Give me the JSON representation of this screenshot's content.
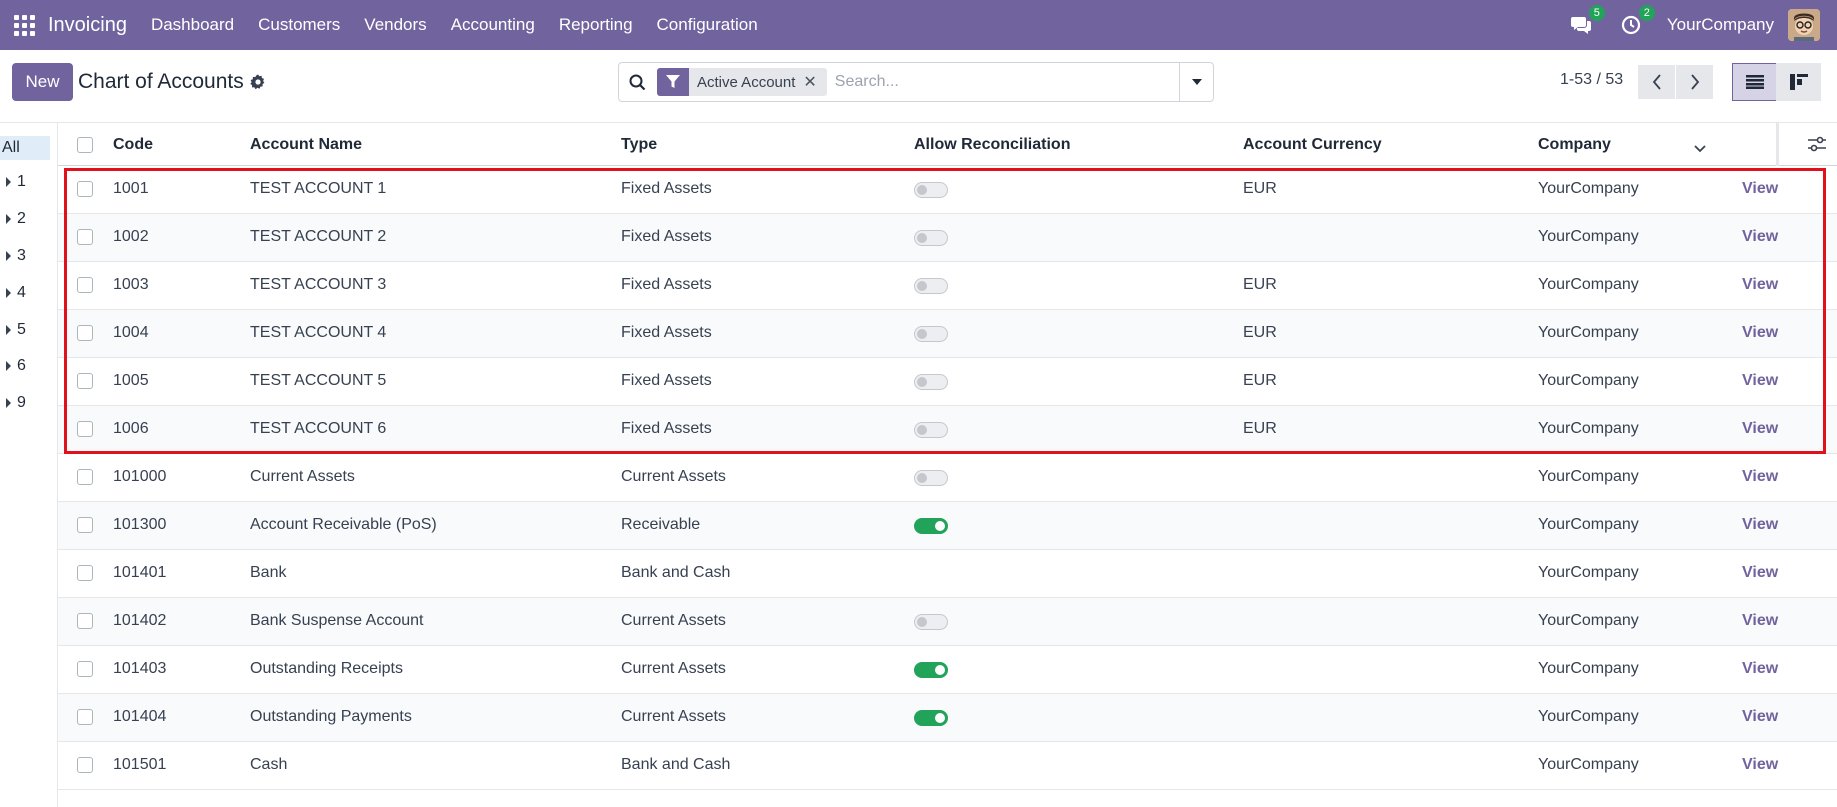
{
  "navbar": {
    "app_name": "Invoicing",
    "menu": [
      "Dashboard",
      "Customers",
      "Vendors",
      "Accounting",
      "Reporting",
      "Configuration"
    ],
    "messages_count": "5",
    "activities_count": "2",
    "company": "YourCompany",
    "bg_color": "#71639e"
  },
  "control": {
    "new_label": "New",
    "title": "Chart of Accounts",
    "search": {
      "facet_label": "Active Account",
      "placeholder": "Search..."
    },
    "pager": "1-53 / 53"
  },
  "sidepanel": {
    "items": [
      "All",
      "1",
      "2",
      "3",
      "4",
      "5",
      "6",
      "9"
    ]
  },
  "table": {
    "headers": {
      "code": "Code",
      "name": "Account Name",
      "type": "Type",
      "reconcile": "Allow Reconciliation",
      "currency": "Account Currency",
      "company": "Company"
    },
    "view_label": "View",
    "rows": [
      {
        "code": "1001",
        "name": "TEST ACCOUNT 1",
        "type": "Fixed Assets",
        "reconcile": "off",
        "currency": "EUR",
        "company": "YourCompany"
      },
      {
        "code": "1002",
        "name": "TEST ACCOUNT 2",
        "type": "Fixed Assets",
        "reconcile": "off",
        "currency": "",
        "company": "YourCompany"
      },
      {
        "code": "1003",
        "name": "TEST ACCOUNT 3",
        "type": "Fixed Assets",
        "reconcile": "off",
        "currency": "EUR",
        "company": "YourCompany"
      },
      {
        "code": "1004",
        "name": "TEST ACCOUNT 4",
        "type": "Fixed Assets",
        "reconcile": "off",
        "currency": "EUR",
        "company": "YourCompany"
      },
      {
        "code": "1005",
        "name": "TEST ACCOUNT 5",
        "type": "Fixed Assets",
        "reconcile": "off",
        "currency": "EUR",
        "company": "YourCompany"
      },
      {
        "code": "1006",
        "name": "TEST ACCOUNT 6",
        "type": "Fixed Assets",
        "reconcile": "off",
        "currency": "EUR",
        "company": "YourCompany"
      },
      {
        "code": "101000",
        "name": "Current Assets",
        "type": "Current Assets",
        "reconcile": "off",
        "currency": "",
        "company": "YourCompany"
      },
      {
        "code": "101300",
        "name": "Account Receivable (PoS)",
        "type": "Receivable",
        "reconcile": "on",
        "currency": "",
        "company": "YourCompany"
      },
      {
        "code": "101401",
        "name": "Bank",
        "type": "Bank and Cash",
        "reconcile": "none",
        "currency": "",
        "company": "YourCompany"
      },
      {
        "code": "101402",
        "name": "Bank Suspense Account",
        "type": "Current Assets",
        "reconcile": "off",
        "currency": "",
        "company": "YourCompany"
      },
      {
        "code": "101403",
        "name": "Outstanding Receipts",
        "type": "Current Assets",
        "reconcile": "on",
        "currency": "",
        "company": "YourCompany"
      },
      {
        "code": "101404",
        "name": "Outstanding Payments",
        "type": "Current Assets",
        "reconcile": "on",
        "currency": "",
        "company": "YourCompany"
      },
      {
        "code": "101501",
        "name": "Cash",
        "type": "Bank and Cash",
        "reconcile": "none",
        "currency": "",
        "company": "YourCompany"
      }
    ]
  }
}
